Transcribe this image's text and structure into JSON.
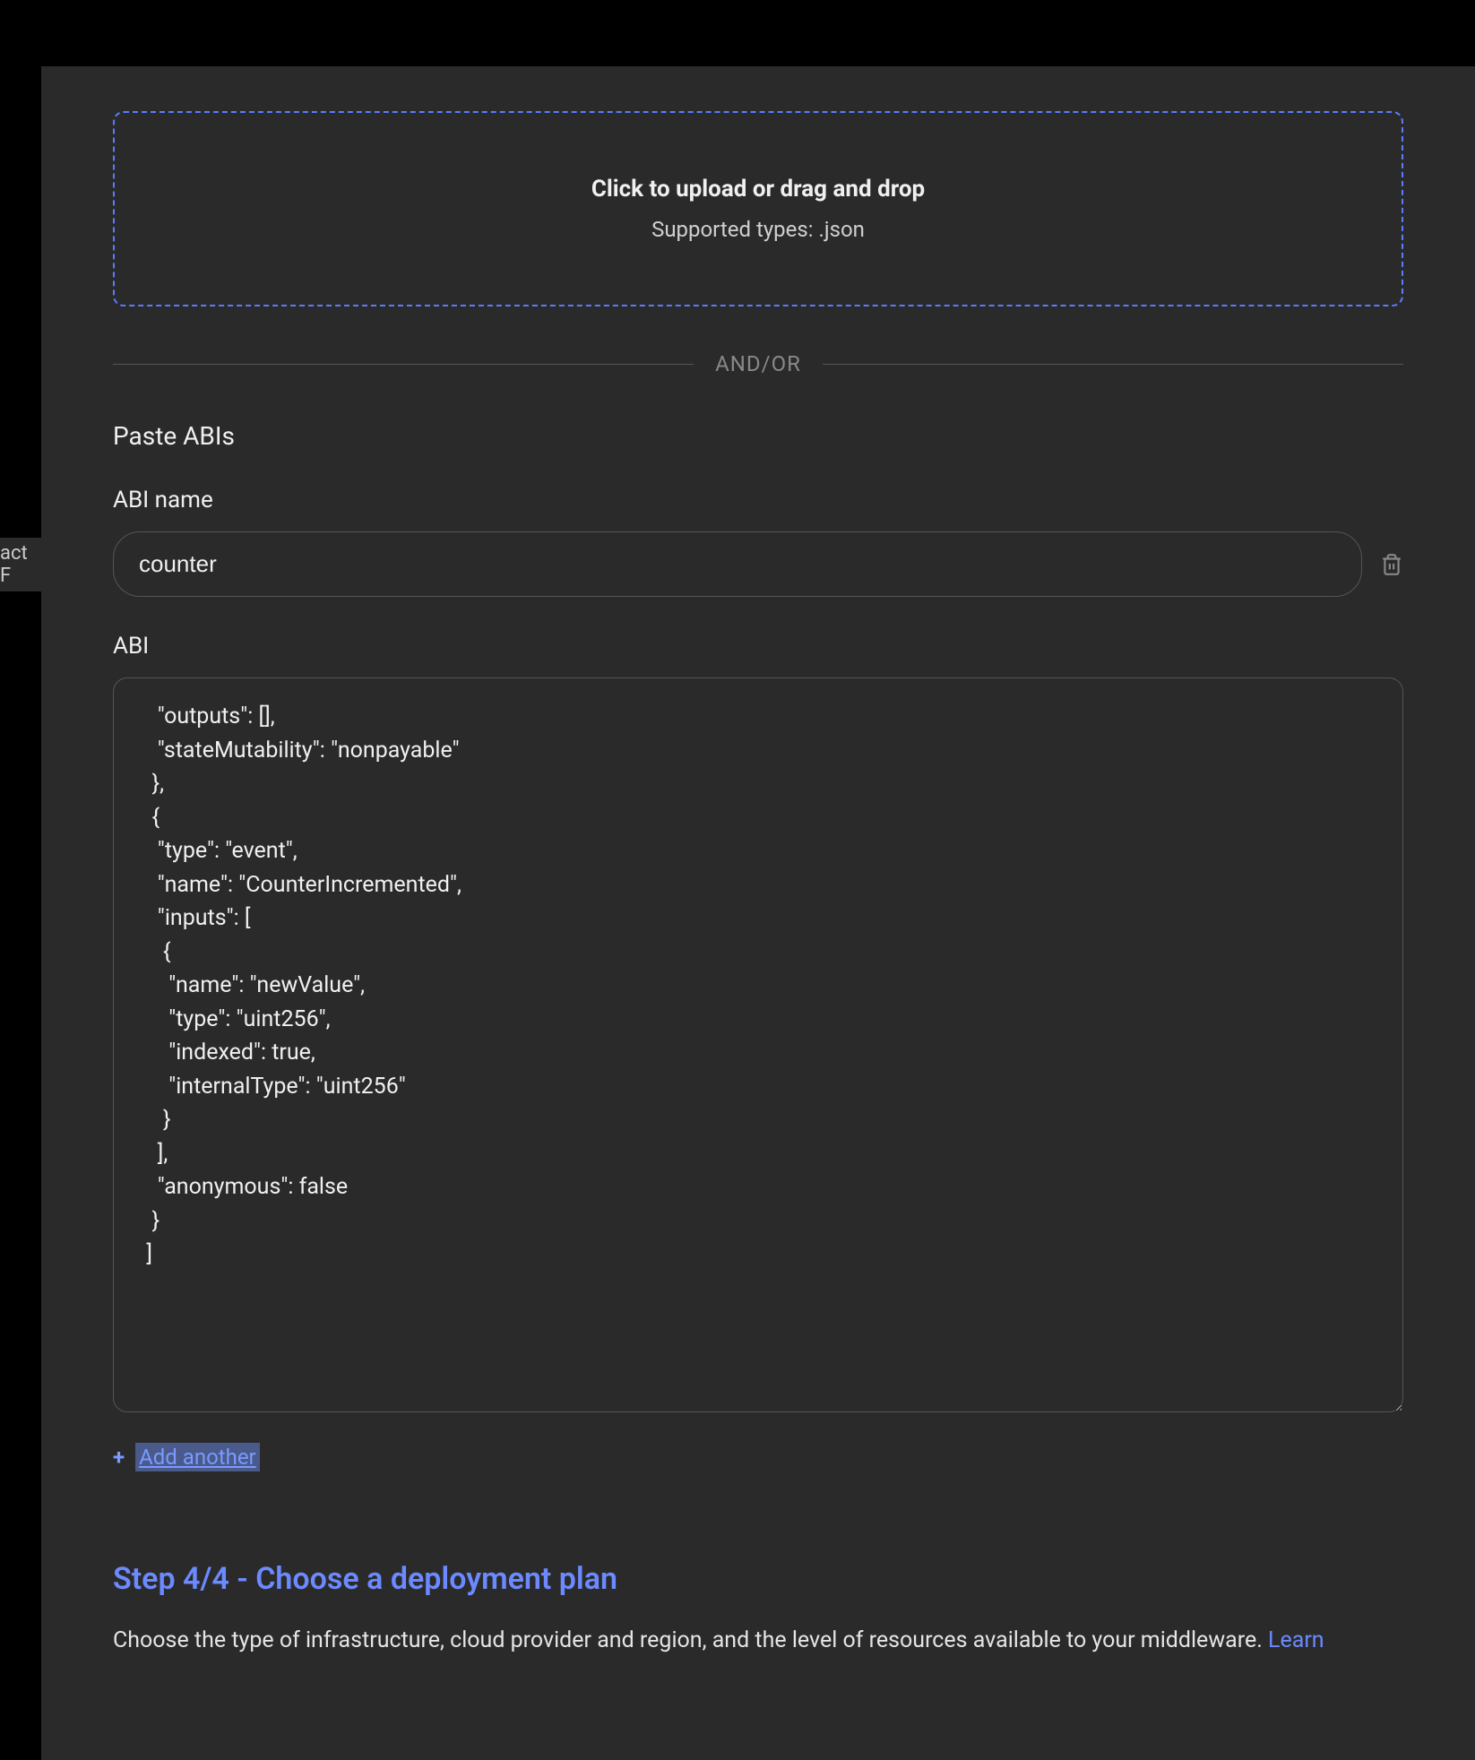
{
  "sidebar": {
    "partial_text": "act F"
  },
  "upload": {
    "title": "Click to upload or drag and drop",
    "subtitle": "Supported types: .json"
  },
  "divider": "AND/OR",
  "paste_section": {
    "title": "Paste ABIs",
    "abi_name_label": "ABI name",
    "abi_name_value": "counter",
    "abi_label": "ABI",
    "abi_value": "    \"outputs\": [],\n    \"stateMutability\": \"nonpayable\"\n   },\n   {\n    \"type\": \"event\",\n    \"name\": \"CounterIncremented\",\n    \"inputs\": [\n     {\n      \"name\": \"newValue\",\n      \"type\": \"uint256\",\n      \"indexed\": true,\n      \"internalType\": \"uint256\"\n     }\n    ],\n    \"anonymous\": false\n   }\n  ]",
    "add_another": "Add another"
  },
  "step4": {
    "heading": "Step 4/4 - Choose a deployment plan",
    "description": "Choose the type of infrastructure, cloud provider and region, and the level of resources available to your middleware. ",
    "learn_link": "Learn"
  }
}
